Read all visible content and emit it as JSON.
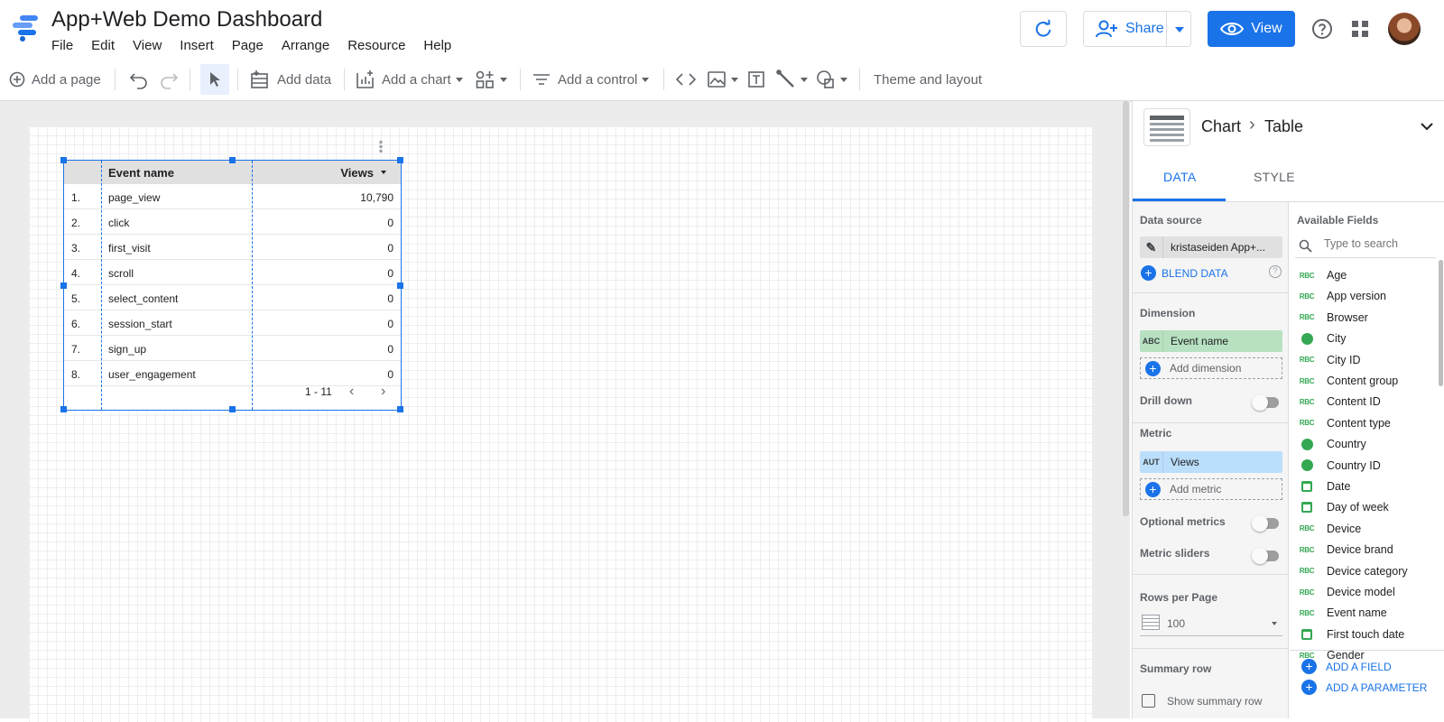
{
  "app": {
    "title": "App+Web Demo Dashboard"
  },
  "menu": [
    "File",
    "Edit",
    "View",
    "Insert",
    "Page",
    "Arrange",
    "Resource",
    "Help"
  ],
  "header": {
    "share_label": "Share",
    "view_label": "View"
  },
  "toolbar": {
    "add_page": "Add a page",
    "add_data": "Add data",
    "add_chart": "Add a chart",
    "add_control": "Add a control",
    "theme_layout": "Theme and layout"
  },
  "table": {
    "col_dimension": "Event name",
    "col_metric": "Views",
    "rows": [
      {
        "num": "1.",
        "name": "page_view",
        "value": "10,790"
      },
      {
        "num": "2.",
        "name": "click",
        "value": "0"
      },
      {
        "num": "3.",
        "name": "first_visit",
        "value": "0"
      },
      {
        "num": "4.",
        "name": "scroll",
        "value": "0"
      },
      {
        "num": "5.",
        "name": "select_content",
        "value": "0"
      },
      {
        "num": "6.",
        "name": "session_start",
        "value": "0"
      },
      {
        "num": "7.",
        "name": "sign_up",
        "value": "0"
      },
      {
        "num": "8.",
        "name": "user_engagement",
        "value": "0"
      }
    ],
    "pagination": "1 - 11"
  },
  "panel": {
    "breadcrumb_root": "Chart",
    "breadcrumb_leaf": "Table",
    "tab_data": "DATA",
    "tab_style": "STYLE",
    "data_source_label": "Data source",
    "data_source_value": "kristaseiden App+...",
    "blend_data": "BLEND DATA",
    "dimension_label": "Dimension",
    "dimension_tag": "ABC",
    "dimension_value": "Event name",
    "add_dimension": "Add dimension",
    "drill_down": "Drill down",
    "metric_label": "Metric",
    "metric_tag": "AUT",
    "metric_value": "Views",
    "add_metric": "Add metric",
    "optional_metrics": "Optional metrics",
    "metric_sliders": "Metric sliders",
    "rows_per_page_label": "Rows per Page",
    "rows_per_page_value": "100",
    "summary_row_label": "Summary row",
    "show_summary_row": "Show summary row",
    "available_fields_label": "Available Fields",
    "search_placeholder": "Type to search",
    "fields": [
      {
        "name": "Age",
        "type": "abc"
      },
      {
        "name": "App version",
        "type": "abc"
      },
      {
        "name": "Browser",
        "type": "abc"
      },
      {
        "name": "City",
        "type": "geo"
      },
      {
        "name": "City ID",
        "type": "abc"
      },
      {
        "name": "Content group",
        "type": "abc"
      },
      {
        "name": "Content ID",
        "type": "abc"
      },
      {
        "name": "Content type",
        "type": "abc"
      },
      {
        "name": "Country",
        "type": "geo"
      },
      {
        "name": "Country ID",
        "type": "geo"
      },
      {
        "name": "Date",
        "type": "date"
      },
      {
        "name": "Day of week",
        "type": "date"
      },
      {
        "name": "Device",
        "type": "abc"
      },
      {
        "name": "Device brand",
        "type": "abc"
      },
      {
        "name": "Device category",
        "type": "abc"
      },
      {
        "name": "Device model",
        "type": "abc"
      },
      {
        "name": "Event name",
        "type": "abc"
      },
      {
        "name": "First touch date",
        "type": "date"
      },
      {
        "name": "Gender",
        "type": "abc"
      }
    ],
    "add_field": "ADD A FIELD",
    "add_parameter": "ADD A PARAMETER"
  },
  "colors": {
    "accent": "#1a73e8",
    "dimension_chip": "#b7e1c1",
    "metric_chip": "#bbdefb",
    "field_icon": "#34a853"
  }
}
